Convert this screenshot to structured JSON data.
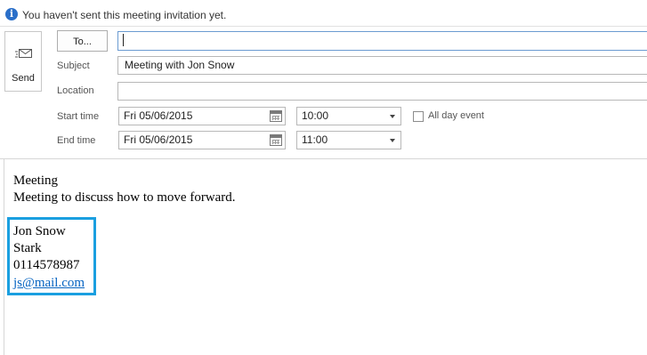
{
  "info_bar": {
    "icon": "info-icon",
    "message": "You haven't sent this meeting invitation yet."
  },
  "toolbar": {
    "send_label": "Send",
    "send_icon": "send-envelope-icon"
  },
  "fields": {
    "to_button": "To...",
    "to_value": "",
    "subject_label": "Subject",
    "subject_value": "Meeting with Jon Snow",
    "location_label": "Location",
    "location_value": "",
    "start_label": "Start time",
    "start_date": "Fri 05/06/2015",
    "start_time": "10:00",
    "end_label": "End time",
    "end_date": "Fri 05/06/2015",
    "end_time": "11:00",
    "all_day_label": "All day event",
    "all_day_checked": false
  },
  "body": {
    "line1": "Meeting",
    "line2": "Meeting to discuss how to move forward.",
    "signature": {
      "name": "Jon Snow",
      "house": "Stark",
      "phone": "0114578987",
      "email": "js@mail.com"
    }
  },
  "colors": {
    "highlight_box": "#1a9fe0",
    "link": "#0563c1",
    "info_icon": "#2a6fc9"
  }
}
